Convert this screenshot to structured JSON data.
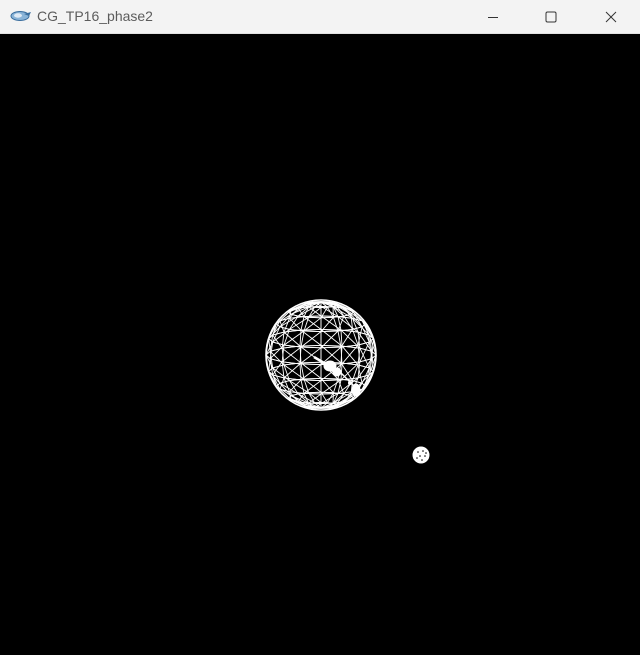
{
  "window": {
    "title": "CG_TP16_phase2",
    "controls": {
      "minimize_icon": "minimize-icon",
      "maximize_icon": "maximize-icon",
      "close_icon": "close-icon"
    }
  },
  "scene": {
    "background_color": "#000000",
    "wire_color": "#ffffff",
    "objects": [
      "wireframe-sphere",
      "small-moon",
      "satellite"
    ]
  }
}
